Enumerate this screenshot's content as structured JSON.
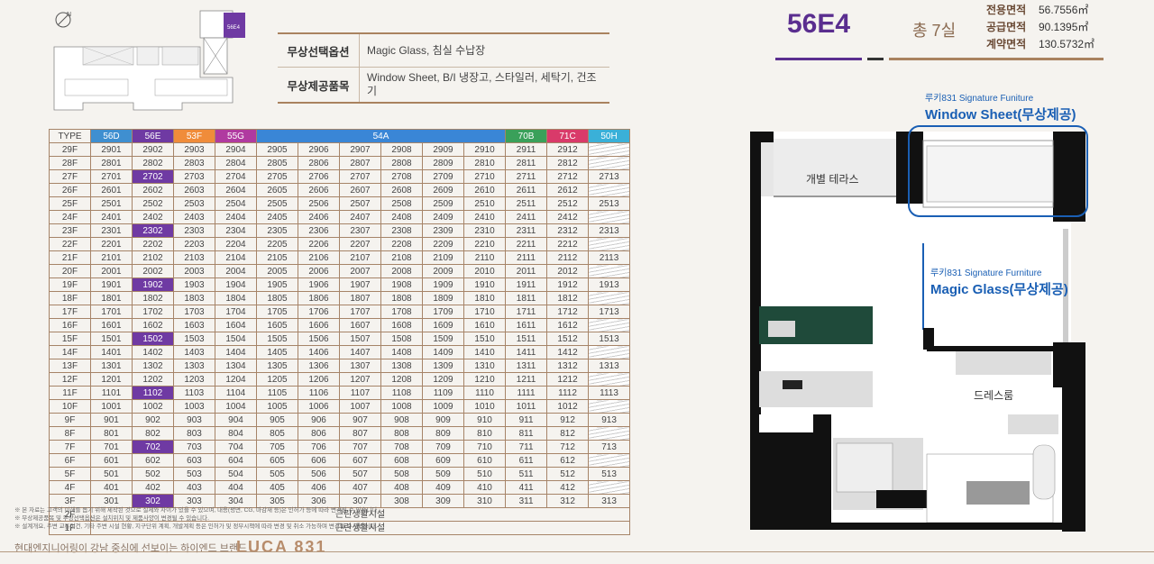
{
  "site_map": {
    "compass": "N",
    "unit_tag": "56E4"
  },
  "options": [
    {
      "label": "무상선택옵션",
      "value": "Magic Glass, 침실 수납장"
    },
    {
      "label": "무상제공품목",
      "value": "Window Sheet, B/I 냉장고, 스타일러, 세탁기, 건조기"
    }
  ],
  "table": {
    "type_label": "TYPE",
    "columns": [
      {
        "name": "56D",
        "color": "#3f8fd0",
        "span": 1
      },
      {
        "name": "56E",
        "color": "#6f3aa3",
        "span": 1
      },
      {
        "name": "53F",
        "color": "#f08c3a",
        "span": 1
      },
      {
        "name": "55G",
        "color": "#b03aa0",
        "span": 1
      },
      {
        "name": "54A",
        "color": "#3a86d6",
        "span": 6
      },
      {
        "name": "70B",
        "color": "#3aa05a",
        "span": 1
      },
      {
        "name": "71C",
        "color": "#d93a6a",
        "span": 1
      },
      {
        "name": "50H",
        "color": "#3ab0d8",
        "span": 1
      }
    ],
    "highlight_column": 1,
    "highlight_floors": [
      "27F",
      "23F",
      "19F",
      "15F",
      "11F",
      "7F",
      "3F"
    ],
    "floors": [
      "29F",
      "28F",
      "27F",
      "26F",
      "25F",
      "24F",
      "23F",
      "22F",
      "21F",
      "20F",
      "19F",
      "18F",
      "17F",
      "16F",
      "15F",
      "14F",
      "13F",
      "12F",
      "11F",
      "10F",
      "9F",
      "8F",
      "7F",
      "6F",
      "5F",
      "4F",
      "3F",
      "2F",
      "1F"
    ],
    "col13_floors": [
      "27F",
      "25F",
      "23F",
      "21F",
      "19F",
      "17F",
      "15F",
      "13F",
      "11F",
      "9F",
      "7F",
      "5F",
      "3F"
    ],
    "lower_note": "근린생활시설"
  },
  "notes": [
    "※ 본 자료는 고객의 이해를 돕기 위해 제작된 것으로 실제와 차이가 있을 수 있으며, 내용(평면, CG, 마감재 등)은 인허가 등에 따라 변경될 수 있습니다.",
    "※ 무상제공품목 및 무상선택옵션은 설치위치 및 제품사양이 변경될 수 있습니다.",
    "※ 설계개요, 주변 교통여건, 기타 주변 시설 현황, 지구단위 계획, 개발계획 등은 인허가 및 정부시책에 따라 변경 및 취소 가능하며 변경될 수 있습니다."
  ],
  "footer": {
    "text": "현대엔지니어링이 강남 중심에 선보이는 하이엔드 브랜드",
    "logo": "LUCA 831"
  },
  "header": {
    "type": "56E4",
    "count": "총 7실",
    "areas": [
      {
        "k": "전용면적",
        "v": "56.7556㎡"
      },
      {
        "k": "공급면적",
        "v": "90.1395㎡"
      },
      {
        "k": "계약면적",
        "v": "130.5732㎡"
      }
    ]
  },
  "plan": {
    "ws_small": "루키831 Signature Funiture",
    "ws_big": "Window Sheet(무상제공)",
    "mg_small": "루키831 Signature Furniture",
    "mg_big": "Magic Glass(무상제공)",
    "terrace": "개별 테라스",
    "dressroom": "드레스룸"
  }
}
